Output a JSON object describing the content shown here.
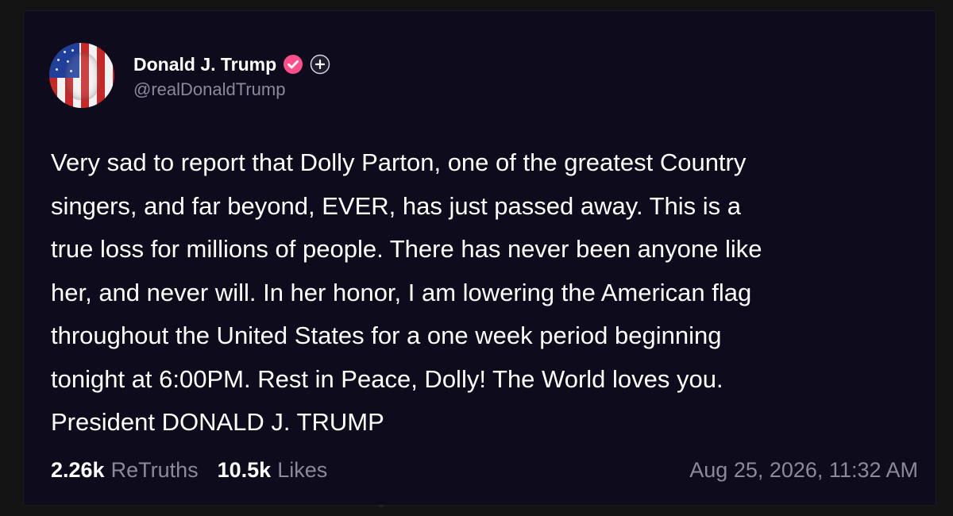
{
  "post": {
    "author": {
      "display_name": "Donald J. Trump",
      "handle": "@realDonaldTrump",
      "verified_icon": "verified-badge-icon",
      "plus_icon": "plus-icon"
    },
    "lines": [
      "Very sad to report that Dolly Parton, one of the greatest Country",
      "singers, and far beyond, EVER, has just passed away. This is a",
      "true loss for millions of people. There has never been anyone like",
      "her, and never will. In her honor, I am lowering the American flag",
      "throughout the United States for a one week period beginning",
      "tonight at 6:00PM. Rest in Peace, Dolly! The World loves you.",
      "President DONALD J. TRUMP"
    ],
    "stats": {
      "retruths_count": "2.26k",
      "retruths_label": "ReTruths",
      "likes_count": "10.5k",
      "likes_label": "Likes"
    },
    "timestamp": "Aug 25, 2026, 11:32 AM"
  },
  "colors": {
    "card_background": "#0d0b1c",
    "text_primary": "#ffffff",
    "text_secondary": "#8a8a9a",
    "verified_badge": "#ff4f8b"
  }
}
